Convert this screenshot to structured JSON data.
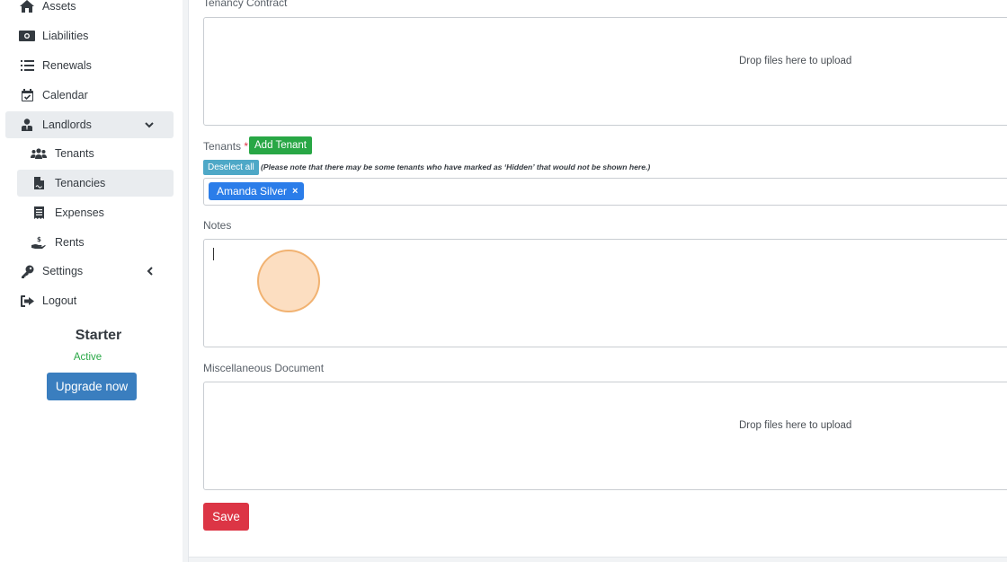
{
  "sidebar": {
    "items": [
      {
        "label": "Assets",
        "icon": "home-icon"
      },
      {
        "label": "Liabilities",
        "icon": "money-bill-icon"
      },
      {
        "label": "Renewals",
        "icon": "list-icon"
      },
      {
        "label": "Calendar",
        "icon": "calendar-check-icon"
      },
      {
        "label": "Landlords",
        "icon": "user-tie-icon",
        "expanded": true
      },
      {
        "label": "Tenants",
        "icon": "users-icon"
      },
      {
        "label": "Tenancies",
        "icon": "file-contract-icon",
        "active": true
      },
      {
        "label": "Expenses",
        "icon": "receipt-icon"
      },
      {
        "label": "Rents",
        "icon": "hand-holding-usd-icon"
      },
      {
        "label": "Settings",
        "icon": "key-icon",
        "expanded": false
      },
      {
        "label": "Logout",
        "icon": "sign-out-icon"
      }
    ]
  },
  "plan": {
    "name": "Starter",
    "status": "Active",
    "upgrade_label": "Upgrade now"
  },
  "form": {
    "tenancy_contract_label": "Tenancy Contract",
    "dropzone_text": "Drop files here to upload",
    "tenants_label": "Tenants",
    "required_mark": "*",
    "add_tenant_label": "Add Tenant",
    "deselect_all_label": "Deselect all",
    "tenants_note": "(Please note that there may be some tenants who have marked as ‘Hidden’ that would not be shown here.)",
    "selected_tenants": [
      "Amanda Silver"
    ],
    "remove_mark": "×",
    "notes_label": "Notes",
    "notes_value": "",
    "misc_document_label": "Miscellaneous Document",
    "save_label": "Save"
  },
  "colors": {
    "save": "#dc3545",
    "add_tenant": "#28a745",
    "upgrade": "#3a7ebf",
    "tag": "#2b7de9",
    "status_active": "#28a745"
  }
}
